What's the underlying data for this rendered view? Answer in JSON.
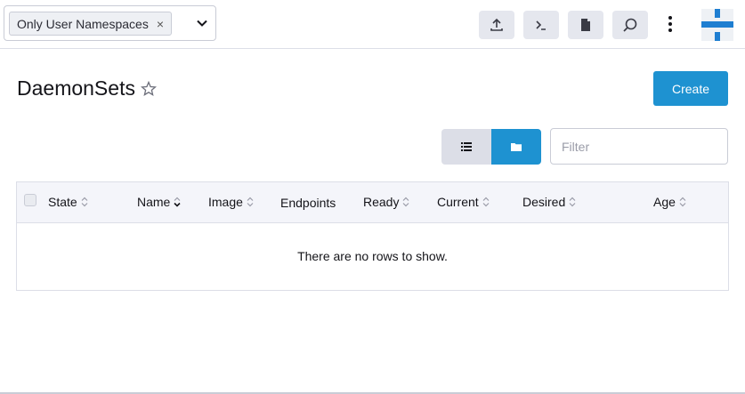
{
  "header": {
    "namespace_filter": {
      "chip_label": "Only User Namespaces",
      "remove_label": "×"
    },
    "tools": [
      "upload-icon",
      "terminal-icon",
      "file-icon",
      "search-icon"
    ],
    "menu_icon": "kebab-icon"
  },
  "page": {
    "title": "DaemonSets",
    "create_label": "Create"
  },
  "toolbar": {
    "filter_placeholder": "Filter",
    "view_modes": [
      "list-icon",
      "folder-icon"
    ],
    "active_view": "folder-icon"
  },
  "table": {
    "columns": [
      "State",
      "Name",
      "Image",
      "Endpoints",
      "Ready",
      "Current",
      "Desired",
      "Age"
    ],
    "empty_message": "There are no rows to show."
  },
  "colors": {
    "accent": "#1e92d1",
    "header_bg": "#f4f5fa",
    "border": "#dcdee7"
  }
}
